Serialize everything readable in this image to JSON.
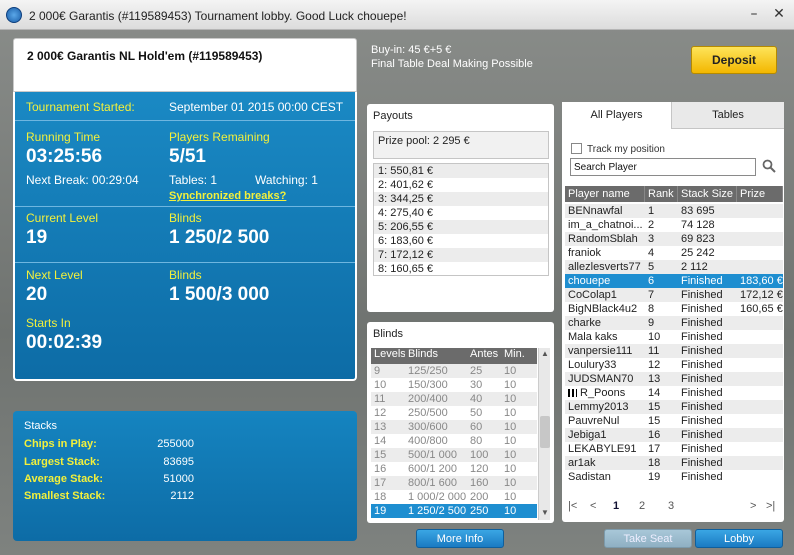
{
  "window": {
    "title": "2 000€ Garantis (#119589453) Tournament lobby. Good Luck chouepe!",
    "minimize": "–",
    "close": "✕"
  },
  "tournament": {
    "name": "2 000€ Garantis  NL Hold'em (#119589453)",
    "started_label": "Tournament Started:",
    "started_value": "September 01 2015   00:00 CEST",
    "running_time_label": "Running Time",
    "running_time": "03:25:56",
    "players_remaining_label": "Players Remaining",
    "players_remaining": "5/51",
    "next_break": "Next Break: 00:29:04",
    "tables": "Tables: 1",
    "watching": "Watching: 1",
    "sync_breaks": "Synchronized breaks?",
    "current_level_label": "Current Level",
    "current_level": "19",
    "blinds_label": "Blinds",
    "current_blinds": "1 250/2 500",
    "next_level_label": "Next Level",
    "next_level": "20",
    "next_blinds_label": "Blinds",
    "next_blinds": "1 500/3 000",
    "starts_in_label": "Starts In",
    "starts_in": "00:02:39"
  },
  "stacks": {
    "title": "Stacks",
    "rows": [
      {
        "label": "Chips in Play:",
        "value": "255000"
      },
      {
        "label": "Largest Stack:",
        "value": "83695"
      },
      {
        "label": "Average Stack:",
        "value": "51000"
      },
      {
        "label": "Smallest Stack:",
        "value": "2112"
      }
    ]
  },
  "info": {
    "buyin": "Buy-in: 45 €+5 €",
    "deal": "Final Table Deal Making Possible",
    "deposit": "Deposit"
  },
  "payouts": {
    "title": "Payouts",
    "prize_pool": "Prize pool: 2 295 €",
    "items": [
      "1: 550,81 €",
      "2: 401,62 €",
      "3: 344,25 €",
      "4: 275,40 €",
      "5: 206,55 €",
      "6: 183,60 €",
      "7: 172,12 €",
      "8: 160,65 €"
    ]
  },
  "blinds": {
    "title": "Blinds",
    "headers": [
      "Levels",
      "Blinds",
      "Antes",
      "Min."
    ],
    "rows": [
      [
        "9",
        "125/250",
        "25",
        "10"
      ],
      [
        "10",
        "150/300",
        "30",
        "10"
      ],
      [
        "11",
        "200/400",
        "40",
        "10"
      ],
      [
        "12",
        "250/500",
        "50",
        "10"
      ],
      [
        "13",
        "300/600",
        "60",
        "10"
      ],
      [
        "14",
        "400/800",
        "80",
        "10"
      ],
      [
        "15",
        "500/1 000",
        "100",
        "10"
      ],
      [
        "16",
        "600/1 200",
        "120",
        "10"
      ],
      [
        "17",
        "800/1 600",
        "160",
        "10"
      ],
      [
        "18",
        "1 000/2 000",
        "200",
        "10"
      ],
      [
        "19",
        "1 250/2 500",
        "250",
        "10"
      ]
    ],
    "selected_index": 10
  },
  "players": {
    "tabs": [
      "All Players",
      "Tables"
    ],
    "track_label": "Track my position",
    "search_value": "Search Player",
    "headers": [
      "Player name",
      "Rank",
      "Stack Size",
      "Prize"
    ],
    "rows": [
      [
        "BENnawfal",
        "1",
        "83 695",
        ""
      ],
      [
        "im_a_chatnoi...",
        "2",
        "74 128",
        ""
      ],
      [
        "RandomSblah",
        "3",
        "69 823",
        ""
      ],
      [
        "franiok",
        "4",
        "25 242",
        ""
      ],
      [
        "allezlesverts77",
        "5",
        "2 112",
        ""
      ],
      [
        "chouepe",
        "6",
        "Finished",
        "183,60 €"
      ],
      [
        "CoColap1",
        "7",
        "Finished",
        "172,12 €"
      ],
      [
        "BigNBlack4u2",
        "8",
        "Finished",
        "160,65 €"
      ],
      [
        "charke",
        "9",
        "Finished",
        ""
      ],
      [
        "Mala kaks",
        "10",
        "Finished",
        ""
      ],
      [
        "vanpersie111",
        "11",
        "Finished",
        ""
      ],
      [
        "Loulury33",
        "12",
        "Finished",
        ""
      ],
      [
        "JUDSMAN70",
        "13",
        "Finished",
        ""
      ],
      [
        "R_Poons",
        "14",
        "Finished",
        ""
      ],
      [
        "Lemmy2013",
        "15",
        "Finished",
        ""
      ],
      [
        "PauvreNul",
        "15",
        "Finished",
        ""
      ],
      [
        "Jebiga1",
        "16",
        "Finished",
        ""
      ],
      [
        "LEKABYLE91",
        "17",
        "Finished",
        ""
      ],
      [
        "ar1ak",
        "18",
        "Finished",
        ""
      ],
      [
        "Sadistan",
        "19",
        "Finished",
        ""
      ]
    ],
    "selected_index": 5,
    "flag_index": 13,
    "pager": {
      "first": "|<",
      "prev": "<",
      "pages": [
        "1",
        "2",
        "3"
      ],
      "next": ">",
      "last": ">|"
    }
  },
  "buttons": {
    "more_info": "More Info",
    "take_seat": "Take Seat",
    "lobby": "Lobby"
  }
}
